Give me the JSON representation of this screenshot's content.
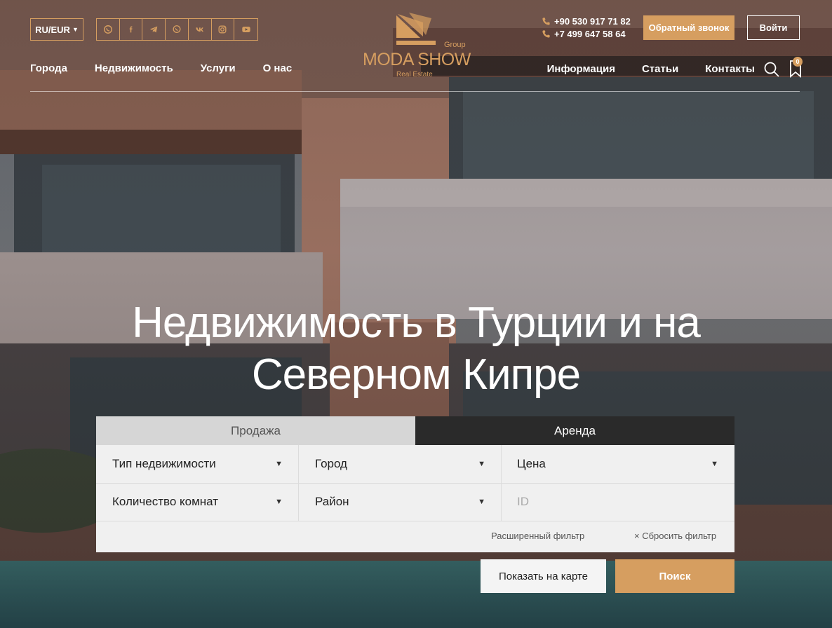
{
  "header": {
    "lang_label": "RU/EUR",
    "socials": [
      {
        "name": "whatsapp-icon"
      },
      {
        "name": "facebook-icon"
      },
      {
        "name": "telegram-icon"
      },
      {
        "name": "viber-icon"
      },
      {
        "name": "vk-icon"
      },
      {
        "name": "instagram-icon"
      },
      {
        "name": "youtube-icon"
      }
    ],
    "nav_left": [
      "Города",
      "Недвижимость",
      "Услуги",
      "О нас"
    ],
    "nav_right": [
      "Информация",
      "Статьи",
      "Контакты"
    ],
    "logo": {
      "group": "Group",
      "name": "MODA SHOW",
      "sub": "Real Estate"
    },
    "phones": [
      "+90 530 917 71 82",
      "+7 499 647 58 64"
    ],
    "callback_label": "Обратный звонок",
    "login_label": "Войти",
    "favorites_count": "0"
  },
  "hero": {
    "title_line1": "Недвижимость в Турции и на",
    "title_line2": "Северном Кипре"
  },
  "filter": {
    "tabs": [
      "Продажа",
      "Аренда"
    ],
    "active_tab": "Продажа",
    "fields": {
      "property_type": "Тип недвижимости",
      "city": "Город",
      "price": "Цена",
      "rooms": "Количество комнат",
      "district": "Район",
      "id_placeholder": "ID"
    },
    "advanced_label": "Расширенный фильтр",
    "reset_label": "Сбросить фильтр",
    "map_button": "Показать на карте",
    "search_button": "Поиск"
  },
  "colors": {
    "accent": "#d69e60",
    "dark_tab": "#2a2a2a",
    "panel_bg": "#f0f0f0"
  }
}
